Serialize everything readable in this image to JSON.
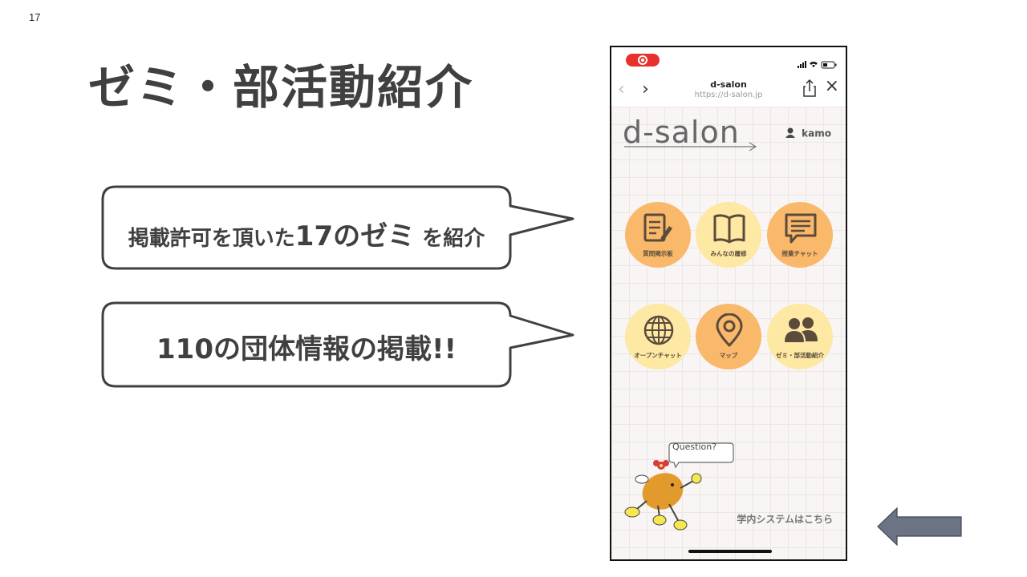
{
  "slide": {
    "number": "17",
    "title": "ゼミ・部活動紹介"
  },
  "bubble1": {
    "prefix": "掲載許可を頂いた",
    "highlight": "17のゼミ",
    "suffix": "を紹介"
  },
  "bubble2": {
    "text": "110の団体情報の掲載!!"
  },
  "phone": {
    "nav": {
      "title": "d-salon",
      "url": "https://d-salon.jp"
    },
    "logo": "d-salon",
    "user": "kamo",
    "menu": [
      {
        "label": "質問掲示板",
        "icon": "notepad-pencil-icon",
        "color": "#f9b86a"
      },
      {
        "label": "みんなの履修",
        "icon": "open-book-icon",
        "color": "#fde8a4"
      },
      {
        "label": "授業チャット",
        "icon": "chat-bubble-icon",
        "color": "#f9b86a"
      },
      {
        "label": "オープンチャット",
        "icon": "globe-icon",
        "color": "#fde8a4"
      },
      {
        "label": "マップ",
        "icon": "map-pin-icon",
        "color": "#f9b86a"
      },
      {
        "label": "ゼミ・部活動紹介",
        "icon": "people-icon",
        "color": "#fde8a4"
      }
    ],
    "mascot_speech": "Question?",
    "bottom_link": "学内システムはこちら"
  },
  "colors": {
    "bubble_border": "#404040",
    "arrow_fill": "#6b7384"
  }
}
